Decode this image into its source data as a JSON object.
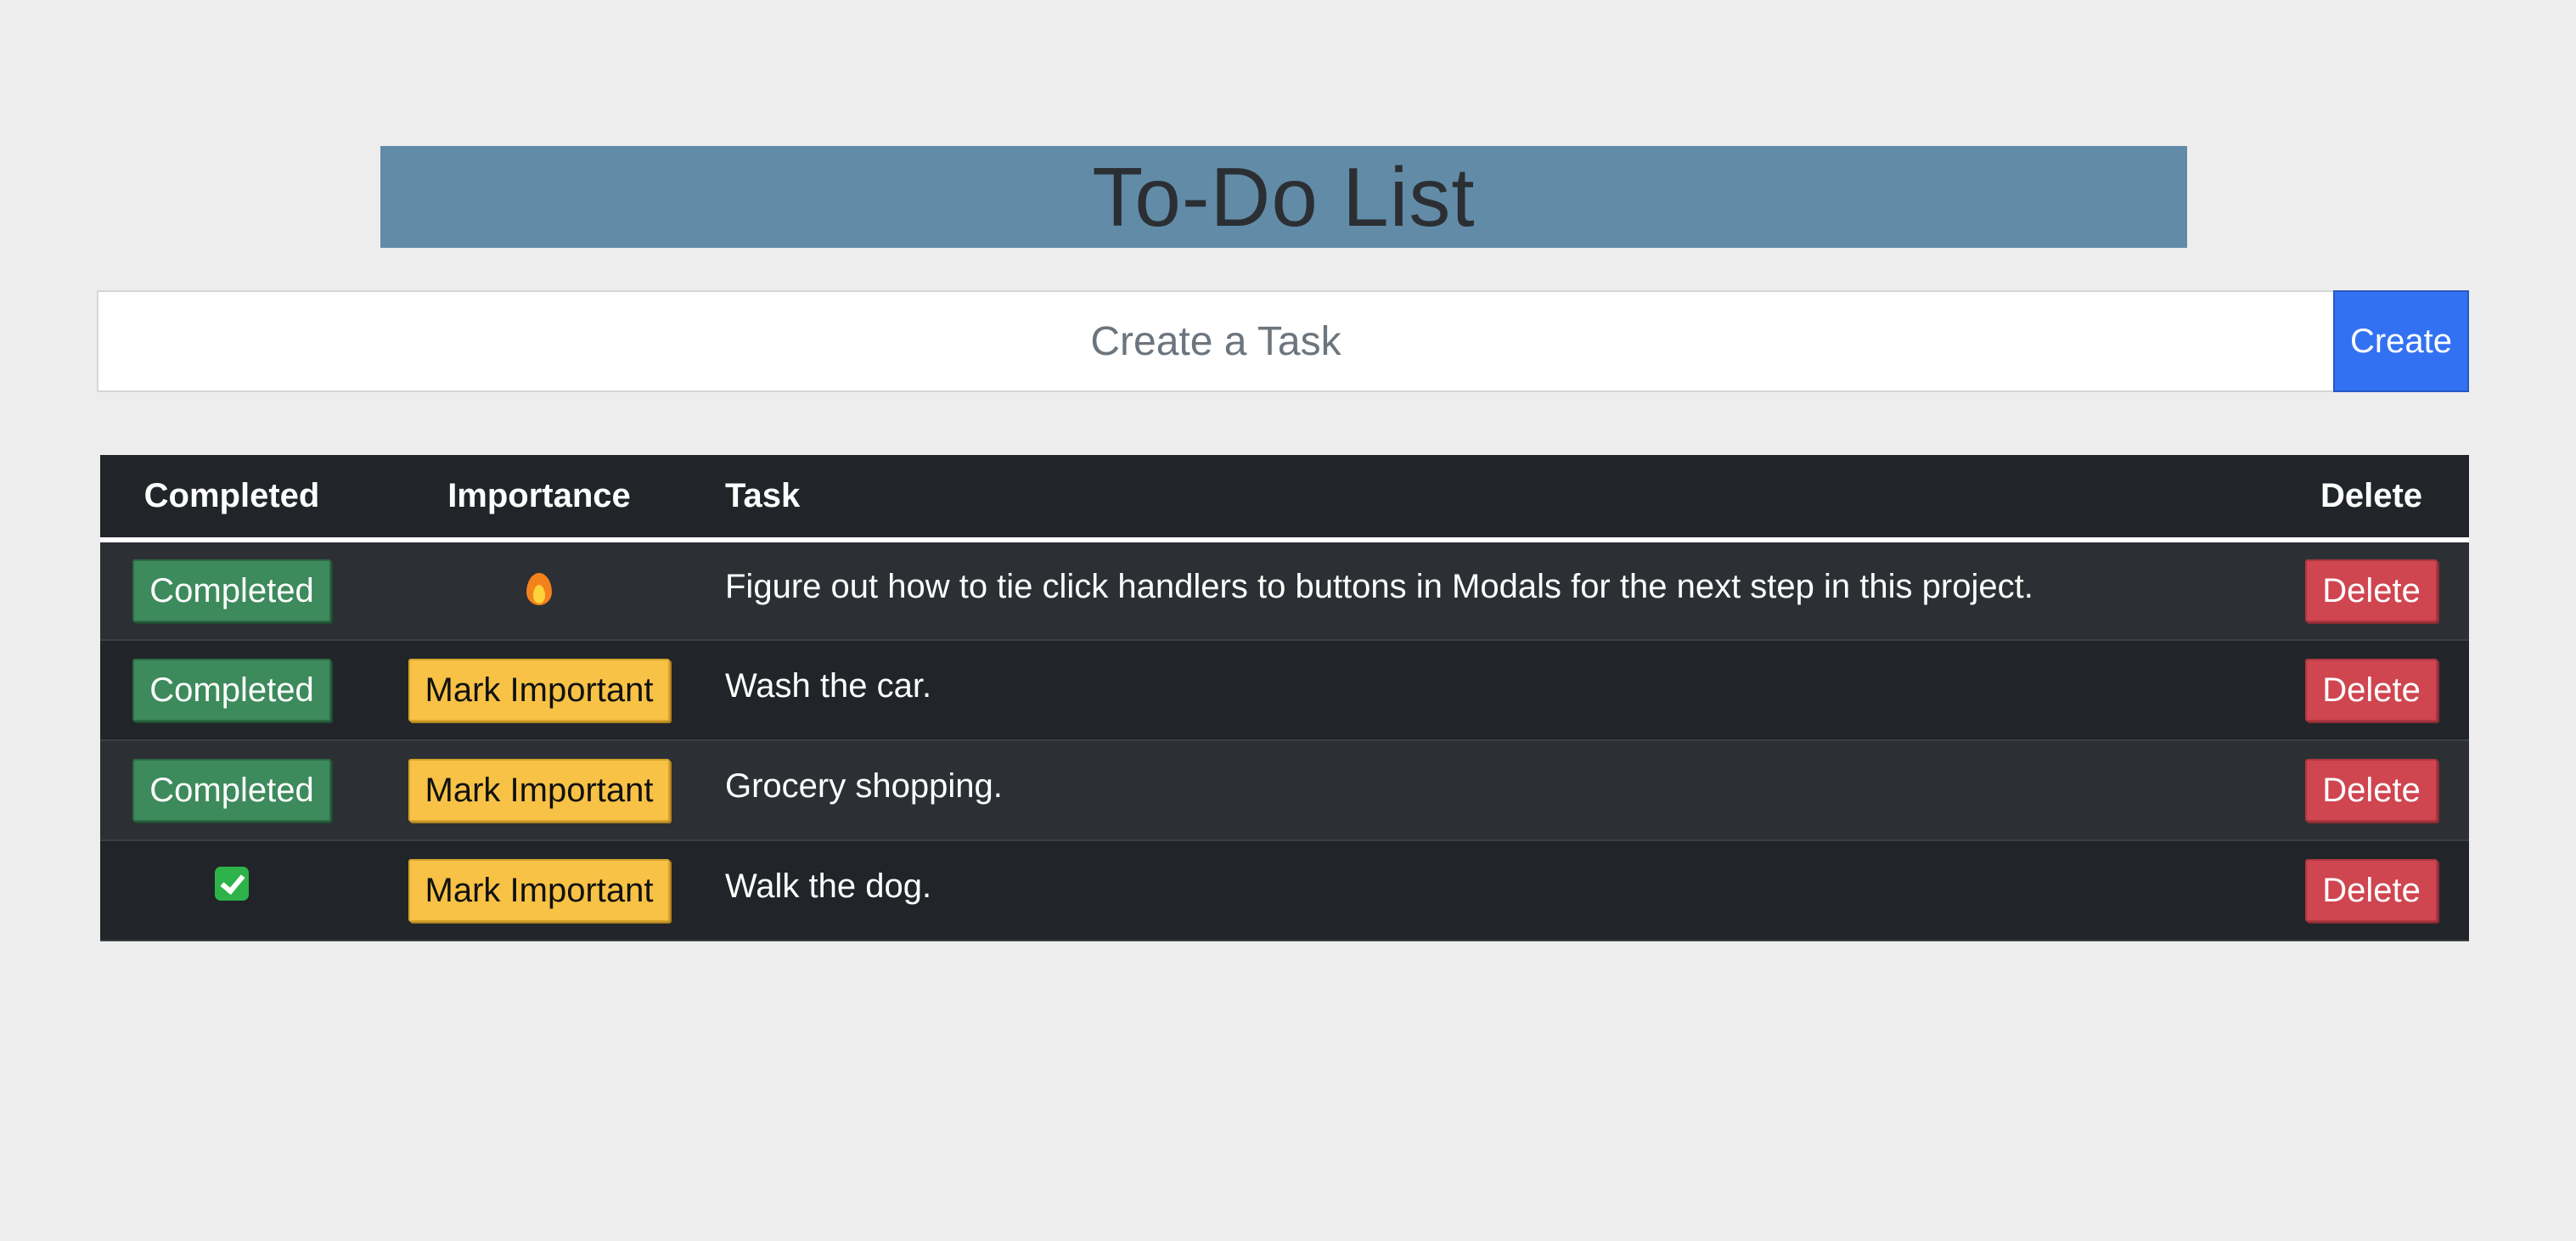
{
  "header": {
    "title": "To-Do List"
  },
  "create": {
    "placeholder": "Create a Task",
    "button_label": "Create"
  },
  "table": {
    "columns": [
      "Completed",
      "Importance",
      "Task",
      "Delete"
    ],
    "rows": [
      {
        "completed_label": "Completed",
        "completed_state": false,
        "importance_label": null,
        "importance_state": "important",
        "importance_icon": "fire-icon",
        "task": "Figure out how to tie click handlers to buttons in Modals for the next step in this project.",
        "delete_label": "Delete"
      },
      {
        "completed_label": "Completed",
        "completed_state": false,
        "importance_label": "Mark Important",
        "importance_state": "normal",
        "task": "Wash the car.",
        "delete_label": "Delete"
      },
      {
        "completed_label": "Completed",
        "completed_state": false,
        "importance_label": "Mark Important",
        "importance_state": "normal",
        "task": "Grocery shopping.",
        "delete_label": "Delete"
      },
      {
        "completed_label": null,
        "completed_state": true,
        "completed_icon": "check-mark-icon",
        "importance_label": "Mark Important",
        "importance_state": "normal",
        "task": "Walk the dog.",
        "delete_label": "Delete"
      }
    ]
  },
  "colors": {
    "title_bar": "#628ba7",
    "create_button": "#3272f2",
    "completed_button": "#3d8a5c",
    "important_button": "#f7c245",
    "delete_button": "#cf4550",
    "table_bg": "#212529"
  }
}
